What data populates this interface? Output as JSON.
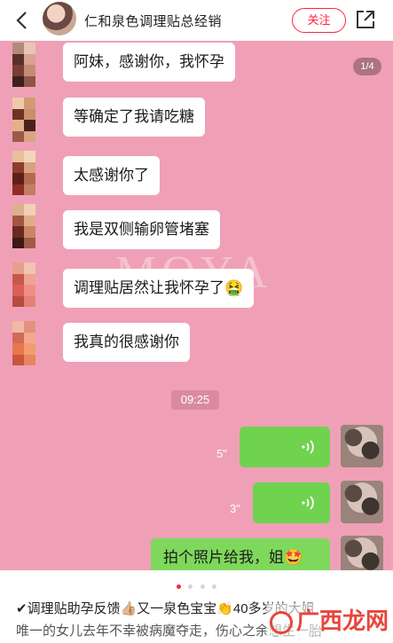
{
  "header": {
    "title": "仁和泉色调理贴总经销",
    "follow_label": "关注"
  },
  "image": {
    "counter": "1/4",
    "watermark": "MOYA",
    "messages": [
      "阿妹，感谢你，我怀孕",
      "等确定了我请吃糖",
      "太感谢你了",
      "我是双侧输卵管堵塞",
      "调理贴居然让我怀孕了🤮",
      "我真的很感谢你"
    ],
    "time": "09:25",
    "voice": [
      {
        "duration": "5\""
      },
      {
        "duration": "3\""
      }
    ],
    "sent_text": "拍个照片给我，姐🤩"
  },
  "caption": {
    "line1": "✔调理贴助孕反馈👍🏼又一泉色宝宝👏40多岁的大姐",
    "line2": "唯一的女儿去年不幸被病魔夺走，伤心之余想生一胎"
  },
  "logo": {
    "text": "广西龙网"
  },
  "colors": {
    "accent": "#ff2442",
    "pink_bg": "#efa0b7",
    "voice_green": "#6fd34f"
  }
}
